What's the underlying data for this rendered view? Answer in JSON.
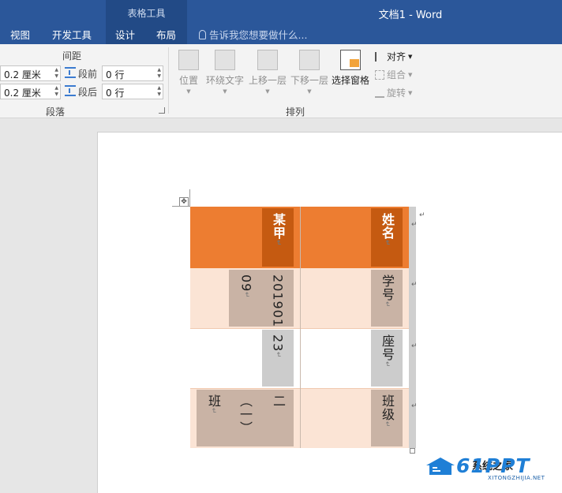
{
  "window": {
    "title": "文档1 - Word",
    "contextual_group": "表格工具"
  },
  "tabs": [
    "视图",
    "开发工具",
    "设计",
    "布局"
  ],
  "tell_me": {
    "placeholder": "告诉我您想要做什么..."
  },
  "ribbon": {
    "paragraph": {
      "group_label": "段落",
      "spacing_header": "间距",
      "indent_left_value": "0.2 厘米",
      "indent_right_value": "0.2 厘米",
      "before_label": "段前",
      "after_label": "段后",
      "before_value": "0 行",
      "after_value": "0 行"
    },
    "arrange": {
      "group_label": "排列",
      "position": "位置",
      "wrap_text": "环绕文字",
      "bring_forward": "上移一层",
      "send_backward": "下移一层",
      "selection_pane": "选择窗格",
      "align": "对齐",
      "group": "组合",
      "rotate": "旋转"
    }
  },
  "table": {
    "rows": [
      {
        "label": "姓名",
        "value": "某甲"
      },
      {
        "label": "学号",
        "value_col1": "201901",
        "value_col2": "09"
      },
      {
        "label": "座号",
        "value": "23"
      },
      {
        "label": "班级",
        "value_col1": "二",
        "value_col2": "（一）",
        "value_col3": "班"
      }
    ]
  },
  "watermark": {
    "brand": "61PPT",
    "site": "XITONGZHIJIA.NET",
    "overlay": "系统之家"
  },
  "colors": {
    "title_bar": "#2b579a",
    "header_orange": "#ed7d31",
    "header_dark": "#c55a11",
    "light_peach": "#fbe4d5",
    "taupe": "#c9b3a5",
    "gray": "#cccccc"
  }
}
